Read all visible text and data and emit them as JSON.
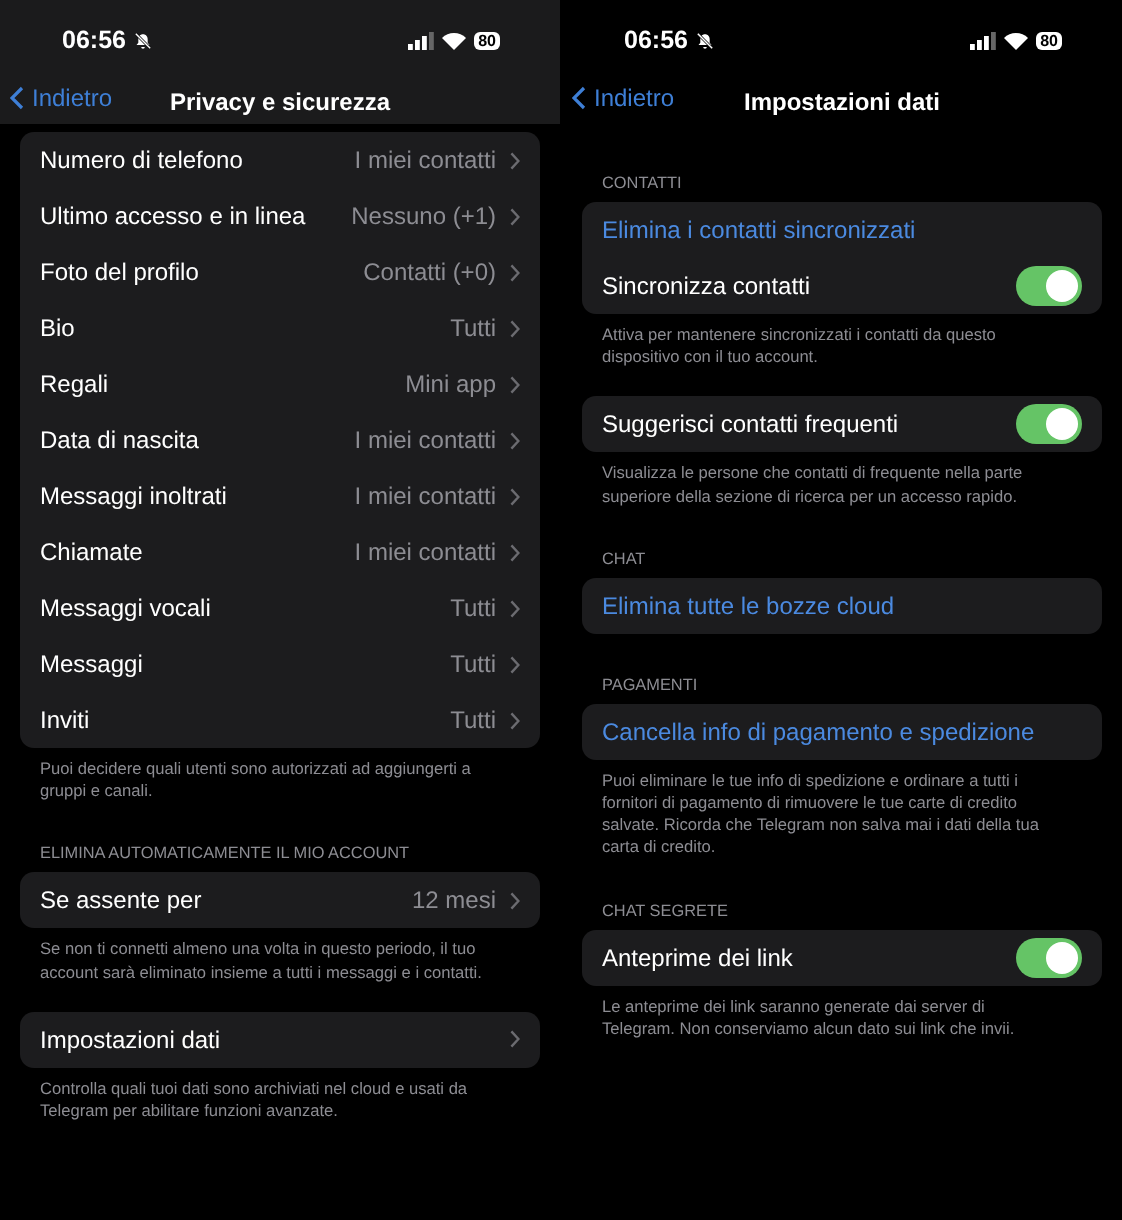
{
  "screens": [
    {
      "status": {
        "time": "06:56",
        "battery": "80"
      },
      "scrolled": true,
      "nav": {
        "back": "Indietro",
        "title": "Privacy e sicurezza"
      },
      "sections": [
        {
          "items": [
            {
              "kind": "disclosure",
              "label": "Numero di telefono",
              "value": "I miei contatti"
            },
            {
              "kind": "disclosure",
              "label": "Ultimo accesso e in linea",
              "value": "Nessuno (+1)"
            },
            {
              "kind": "disclosure",
              "label": "Foto del profilo",
              "value": "Contatti (+0)"
            },
            {
              "kind": "disclosure",
              "label": "Bio",
              "value": "Tutti"
            },
            {
              "kind": "disclosure",
              "label": "Regali",
              "value": "Mini app"
            },
            {
              "kind": "disclosure",
              "label": "Data di nascita",
              "value": "I miei contatti"
            },
            {
              "kind": "disclosure",
              "label": "Messaggi inoltrati",
              "value": "I miei contatti"
            },
            {
              "kind": "disclosure",
              "label": "Chiamate",
              "value": "I miei contatti"
            },
            {
              "kind": "disclosure",
              "label": "Messaggi vocali",
              "value": "Tutti"
            },
            {
              "kind": "disclosure",
              "label": "Messaggi",
              "value": "Tutti"
            },
            {
              "kind": "disclosure",
              "label": "Inviti",
              "value": "Tutti"
            }
          ],
          "footer": "Puoi decidere quali utenti sono autorizzati ad aggiungerti a gruppi e canali."
        },
        {
          "header": "ELIMINA AUTOMATICAMENTE IL MIO ACCOUNT",
          "items": [
            {
              "kind": "disclosure",
              "label": "Se assente per",
              "value": "12 mesi"
            }
          ],
          "footer": "Se non ti connetti almeno una volta in questo periodo, il tuo account sarà eliminato insieme a tutti i messaggi e i contatti."
        },
        {
          "items": [
            {
              "kind": "disclosure",
              "label": "Impostazioni dati"
            }
          ],
          "footer": "Controlla quali tuoi dati sono archiviati nel cloud e usati da Telegram per abilitare funzioni avanzate."
        }
      ]
    },
    {
      "status": {
        "time": "06:56",
        "battery": "80"
      },
      "scrolled": false,
      "nav": {
        "back": "Indietro",
        "title": "Impostazioni dati"
      },
      "sections": [
        {
          "header": "CONTATTI",
          "items": [
            {
              "kind": "action",
              "label": "Elimina i contatti sincronizzati"
            },
            {
              "kind": "toggle",
              "label": "Sincronizza contatti",
              "on": true
            }
          ],
          "footer": "Attiva per mantenere sincronizzati i contatti da questo dispositivo con il tuo account."
        },
        {
          "items": [
            {
              "kind": "toggle",
              "label": "Suggerisci contatti frequenti",
              "on": true
            }
          ],
          "footer": "Visualizza le persone che contatti di frequente nella parte superiore della sezione di ricerca per un accesso rapido."
        },
        {
          "header": "CHAT",
          "items": [
            {
              "kind": "action",
              "label": "Elimina tutte le bozze cloud"
            }
          ]
        },
        {
          "header": "PAGAMENTI",
          "items": [
            {
              "kind": "action",
              "label": "Cancella info di pagamento e spedizione"
            }
          ],
          "footer": "Puoi eliminare le tue info di spedizione e ordinare a tutti i fornitori di pagamento di rimuovere le tue carte di credito salvate. Ricorda che Telegram non salva mai i dati della tua carta di credito."
        },
        {
          "header": "CHAT SEGRETE",
          "items": [
            {
              "kind": "toggle",
              "label": "Anteprime dei link",
              "on": true
            }
          ],
          "footer": "Le anteprime dei link saranno generate dai server di Telegram. Non conserviamo alcun dato sui link che invii."
        }
      ]
    }
  ]
}
